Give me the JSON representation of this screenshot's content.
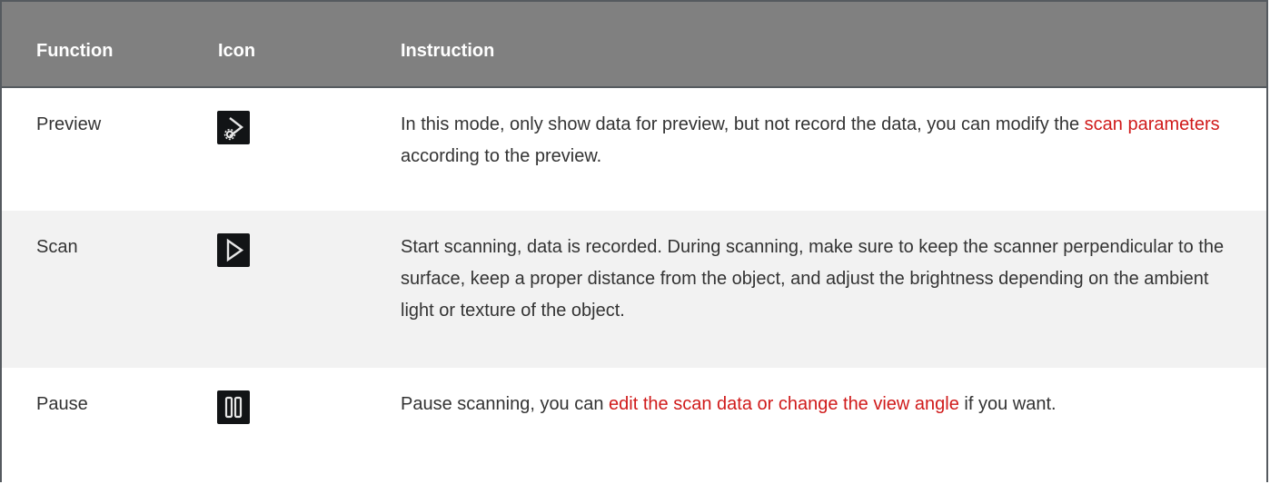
{
  "table": {
    "headers": {
      "function": "Function",
      "icon": "Icon",
      "instruction": "Instruction"
    },
    "rows": [
      {
        "function": "Preview",
        "icon": "preview-icon",
        "instruction_parts": [
          "In this mode, only show data for preview, but not record the data, you can modify the ",
          "scan parameters",
          " according to the preview."
        ]
      },
      {
        "function": "Scan",
        "icon": "play-icon",
        "instruction": "Start scanning, data is recorded. During scanning, make sure to keep the scanner perpendicular to the surface, keep a proper distance from the object, and adjust the brightness depending on the ambient light or texture of the object."
      },
      {
        "function": "Pause",
        "icon": "pause-icon",
        "instruction_parts": [
          "Pause scanning, you can ",
          "edit the scan data or change the view angle",
          " if you want."
        ]
      }
    ]
  },
  "colors": {
    "header_bg": "#808080",
    "link": "#d01a1a",
    "icon_bg": "#121416",
    "row_alt_bg": "#f2f2f2"
  }
}
